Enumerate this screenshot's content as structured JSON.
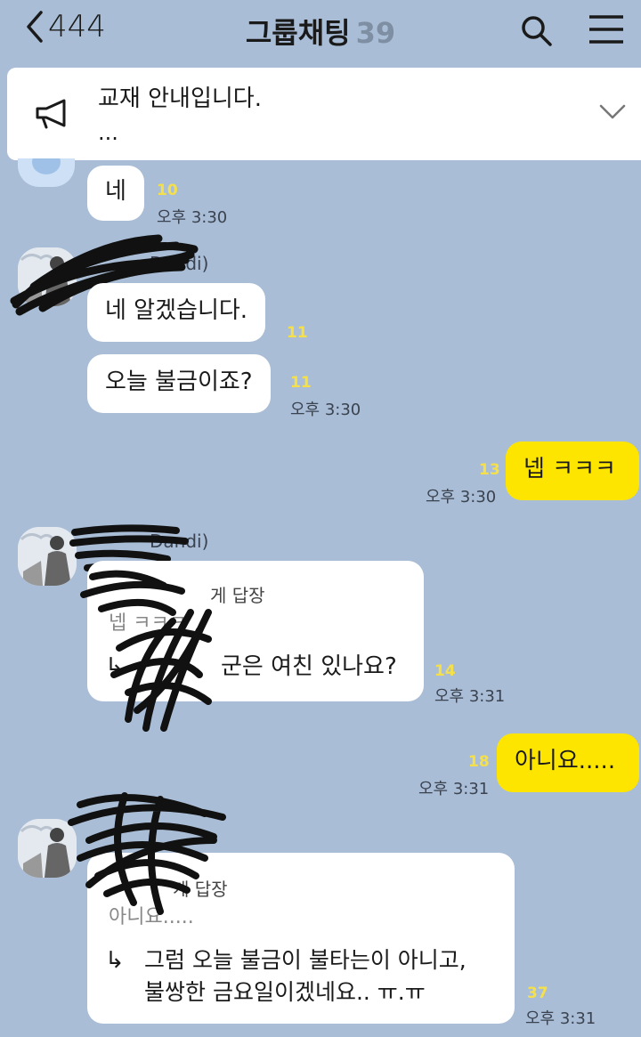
{
  "header": {
    "back_label": "444",
    "title": "그룹채팅",
    "member_count": "39"
  },
  "notice": {
    "text": "교재 안내입니다.",
    "more": "..."
  },
  "messages": {
    "m1": {
      "text": "네",
      "unread": "10",
      "time": "오후 3:30"
    },
    "sender1_name": "Dandi)",
    "m2": {
      "text": "네 알겠습니다.",
      "unread": "11"
    },
    "m3": {
      "text": "오늘 불금이죠?",
      "unread": "11",
      "time": "오후 3:30"
    },
    "m4": {
      "text": "넵 ㅋㅋㅋ",
      "unread": "13",
      "time": "오후 3:30"
    },
    "sender2_name": "Dandi)",
    "m5": {
      "reply_head": "게 답장",
      "reply_quote": "넵 ㅋㅋㅋ",
      "arrow": "↳",
      "text": "군은 여친 있나요?",
      "unread": "14",
      "time": "오후 3:31"
    },
    "m6": {
      "text": "아니요.....",
      "unread": "18",
      "time": "오후 3:31"
    },
    "m7": {
      "reply_head": "게 답장",
      "reply_quote": "아니요.....",
      "arrow": "↳",
      "line1": "그럼 오늘 불금이 불타는이 아니고,",
      "line2": "불쌍한 금요일이겠네요.. ㅠ.ㅠ",
      "unread": "37",
      "time": "오후 3:31"
    }
  },
  "colors": {
    "background": "#a9bed6",
    "my_bubble": "#fee500",
    "other_bubble": "#ffffff",
    "unread": "#f5e04a"
  },
  "icons": [
    "back-chevron-icon",
    "search-icon",
    "menu-icon",
    "megaphone-icon",
    "chevron-down-icon"
  ]
}
